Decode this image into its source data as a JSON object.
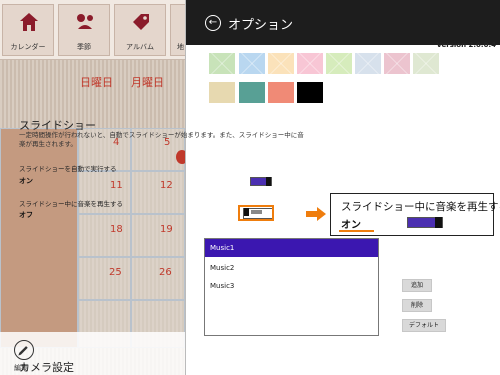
{
  "app": {
    "nav": [
      "カレンダー",
      "季節",
      "アルバム",
      "地"
    ],
    "days": [
      "日曜日",
      "月曜日"
    ],
    "dates": [
      "4",
      "5",
      "11",
      "12",
      "18",
      "19",
      "25",
      "26"
    ],
    "edit_label": "編集"
  },
  "panel": {
    "title": "オプション",
    "version": "Version 2.0.0.4",
    "swatches": [
      "#c8e3b9",
      "#b9d7f0",
      "#fbe2ba",
      "#f8c6d5",
      "#d6ecbc",
      "#d7e1ec",
      "#ecc4cf",
      "#dfe8d2",
      "#e7d9b0",
      "#58a095",
      "#f08a76",
      "#000000"
    ],
    "slideshow": {
      "heading": "スライドショー",
      "description": "一定時間操作が行われないと、自動でスライドショーが始まります。また、スライドショー中に音楽が再生されます。",
      "auto_label": "スライドショーを自動で実行する",
      "auto_state": "オン",
      "music_label": "スライドショー中に音楽を再生する",
      "music_state": "オフ"
    },
    "callout": {
      "label": "スライドショー中に音楽を再生する",
      "state": "オン"
    },
    "music_list": [
      "Music1",
      "Music2",
      "Music3"
    ],
    "buttons": {
      "add": "追加",
      "delete": "削除",
      "default": "デフォルト"
    },
    "camera_heading": "カメラ設定"
  }
}
